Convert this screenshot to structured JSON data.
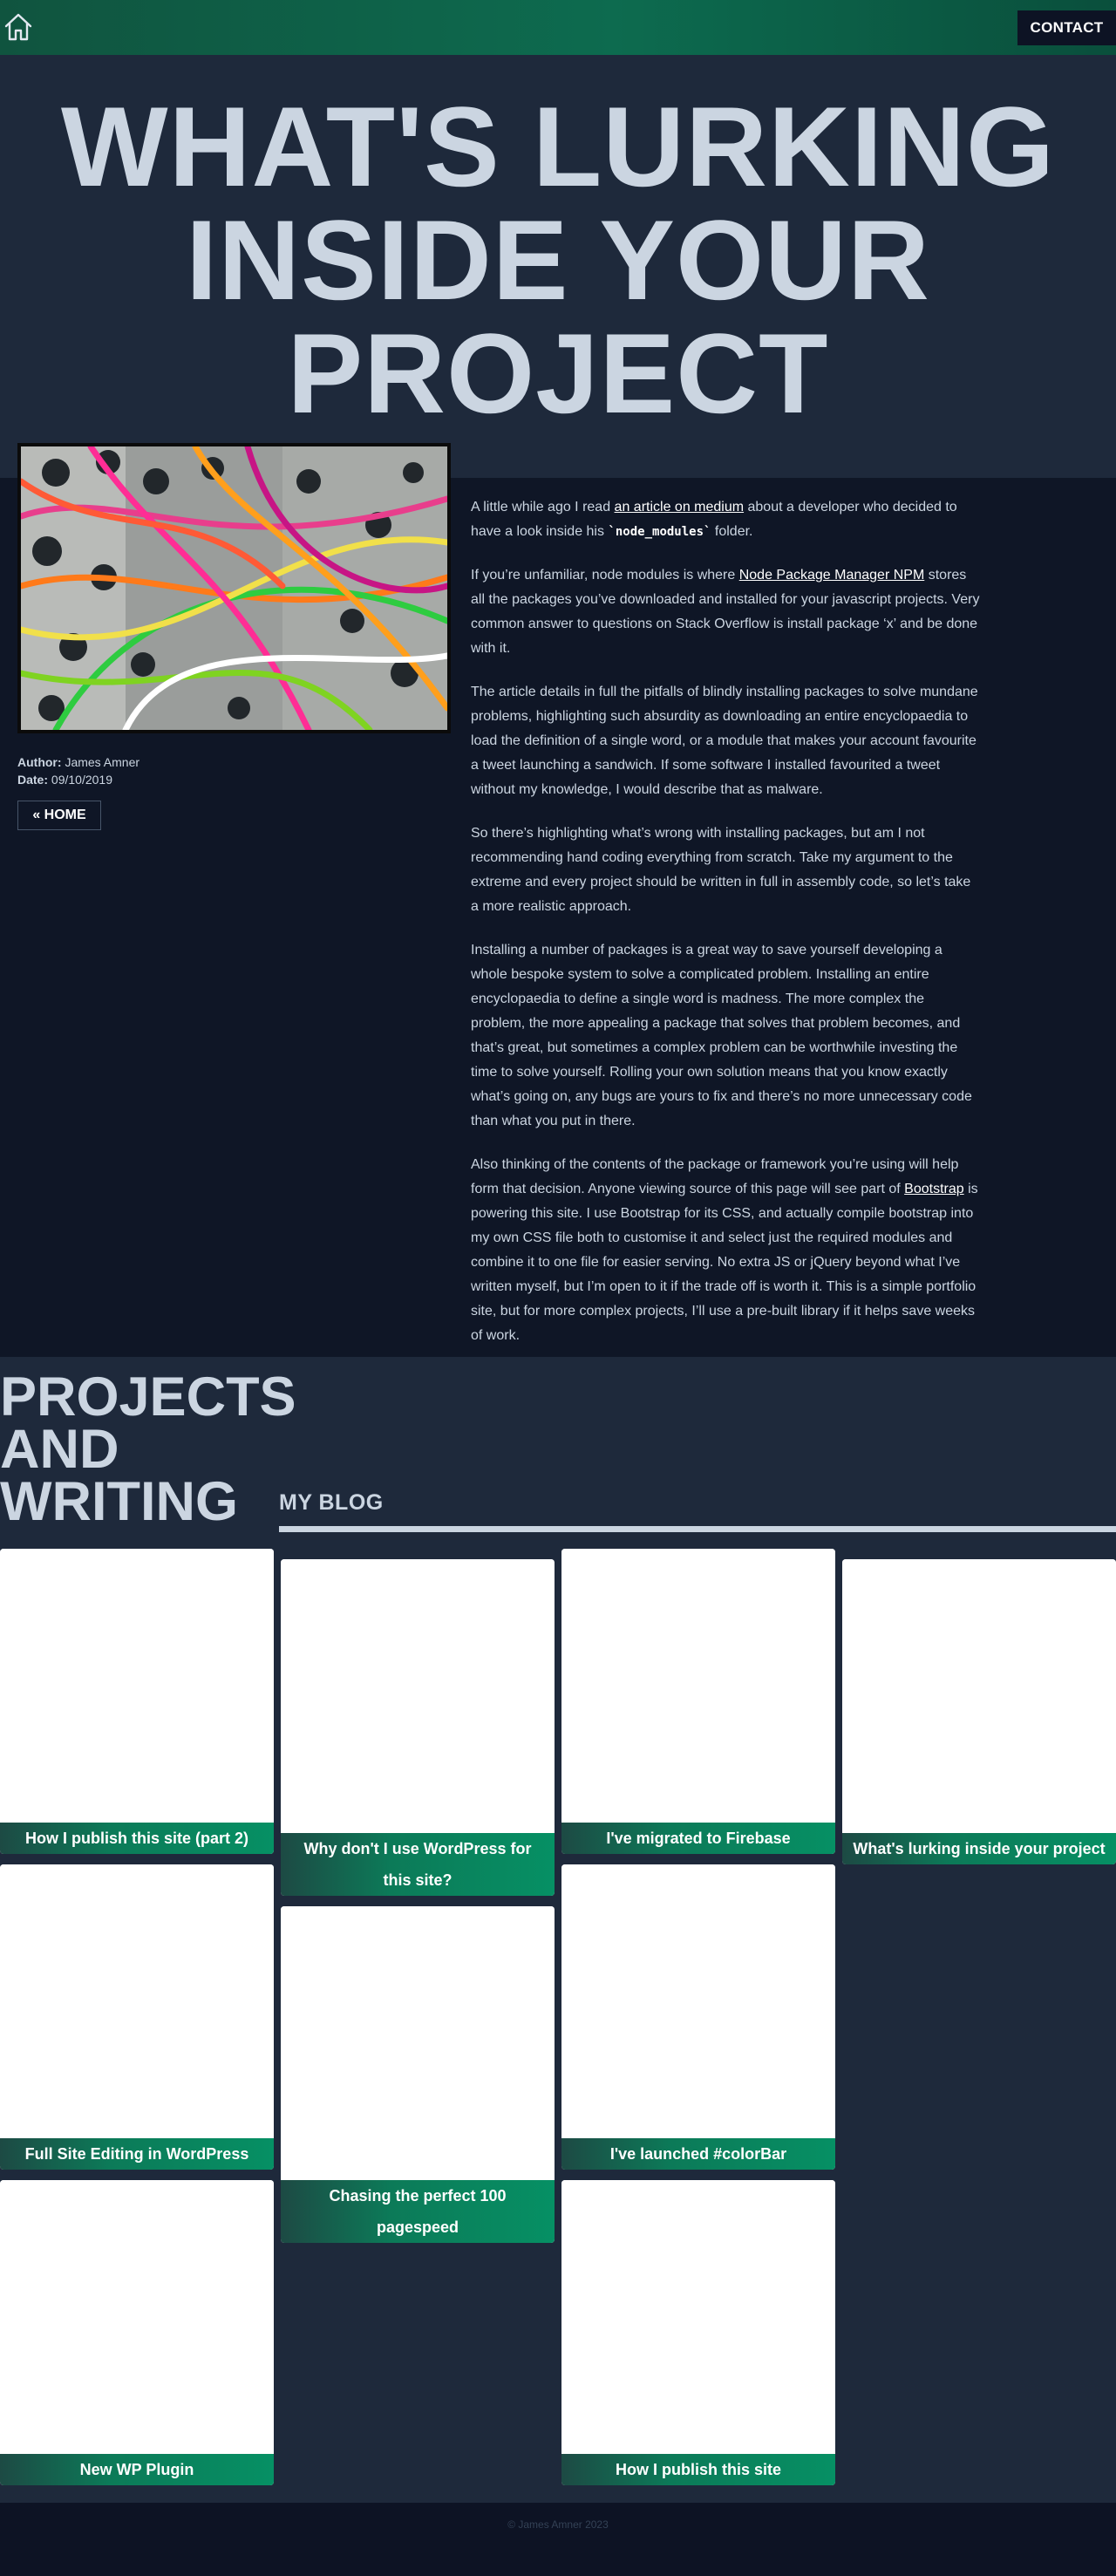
{
  "nav": {
    "home_icon": "home-icon",
    "contact_label": "CONTACT"
  },
  "hero": {
    "title": "WHAT'S LURKING INSIDE YOUR PROJECT"
  },
  "article": {
    "meta": {
      "author_label": "Author:",
      "author": "James Amner",
      "date_label": "Date:",
      "date": "09/10/2019"
    },
    "home_button": "« HOME",
    "p1": {
      "a": "A little while ago I read ",
      "link": "an article on medium",
      "b": " about a developer who decided to have a look inside his ",
      "code": "`node_modules`",
      "c": " folder."
    },
    "p2": {
      "a": "If you’re unfamiliar, node modules is where ",
      "link": "Node Package Manager NPM",
      "b": " stores all the packages you’ve downloaded and installed for your javascript projects. Very common answer to questions on Stack Overflow is install package ‘x’ and be done with it."
    },
    "p3": "The article details in full the pitfalls of blindly installing packages to solve mundane problems, highlighting such absurdity as downloading an entire encyclopaedia to load the definition of a single word, or a module that makes your account favourite a tweet launching a sandwich. If some software I installed favourited a tweet without my knowledge, I would describe that as malware.",
    "p4": "So there’s highlighting what’s wrong with installing packages, but am I not recommending hand coding everything from scratch. Take my argument to the extreme and every project should be written in full in assembly code, so let’s take a more realistic approach.",
    "p5": "Installing a number of packages is a great way to save yourself developing a whole bespoke system to solve a complicated problem. Installing an entire encyclopaedia to define a single word is madness. The more complex the problem, the more appealing a package that solves that problem becomes, and that’s great, but sometimes a complex problem can be worthwhile investing the time to solve yourself. Rolling your own solution means that you know exactly what’s going on, any bugs are yours to fix and there’s no more unnecessary code than what you put in there.",
    "p6": {
      "a": "Also thinking of the contents of the package or framework you’re using will help form that decision. Anyone viewing source of this page will see part of ",
      "link": "Bootstrap",
      "b": " is powering this site. I use Bootstrap for its CSS, and actually compile bootstrap into my own CSS file both to customise it and select just the required modules and combine it to one file for easier serving. No extra JS or jQuery beyond what I’ve written myself, but I’m open to it if the trade off is worth it. This is a simple portfolio site, but for more complex projects, I’ll use a pre-built library if it helps save weeks of work."
    }
  },
  "projects": {
    "title_lines": [
      "PROJECTS",
      "AND",
      "WRITING"
    ],
    "blog_heading": "MY BLOG",
    "cards": [
      "How I publish this site (part 2)",
      "Full Site Editing in WordPress",
      "New WP Plugin",
      "Why don't I use WordPress for this site?",
      "Chasing the perfect 100 pagespeed",
      "I've migrated to Firebase",
      "I've launched #colorBar",
      "How I publish this site",
      "What's lurking inside your project"
    ]
  },
  "footer": {
    "copyright": "© James Amner 2023"
  },
  "colors": {
    "nav_green": "#0d6b4f",
    "hero_bg": "#1e293b",
    "body_bg": "#0f1626",
    "heading_text": "#cbd5e1",
    "card_label_green": "#069064"
  }
}
